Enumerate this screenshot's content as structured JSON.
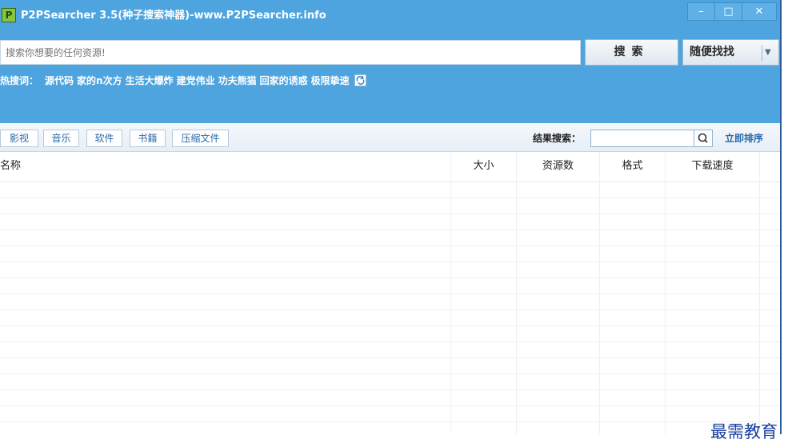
{
  "window": {
    "title": "P2PSearcher 3.5(种子搜索神器)-www.P2PSearcher.info",
    "app_icon_letter": "P",
    "controls": {
      "minimize": "–",
      "maximize": "□",
      "close": "✕"
    }
  },
  "search": {
    "placeholder": "搜索你想要的任何资源!",
    "value": "",
    "button_label": "搜索",
    "random_button_label": "随便找找",
    "random_dropdown_icon": "chevron-down-icon"
  },
  "hotwords": {
    "label": "热搜词：",
    "items": [
      "源代码",
      "家的n次方",
      "生活大爆炸",
      "建党伟业",
      "功夫熊猫",
      "回家的诱惑",
      "极限挚速"
    ],
    "refresh_icon": "refresh-icon"
  },
  "categories": [
    "影视",
    "音乐",
    "软件",
    "书籍",
    "压缩文件"
  ],
  "result_filter": {
    "label": "结果搜索：",
    "value": "",
    "button_icon": "search-icon",
    "sort_label": "立即排序"
  },
  "table": {
    "columns": [
      "名称",
      "大小",
      "资源数",
      "格式",
      "下载速度"
    ],
    "rows": []
  },
  "watermark": "最需教育",
  "colors": {
    "accent": "#4da4df",
    "link": "#2b6aa8",
    "watermark": "#1a3fa0"
  }
}
